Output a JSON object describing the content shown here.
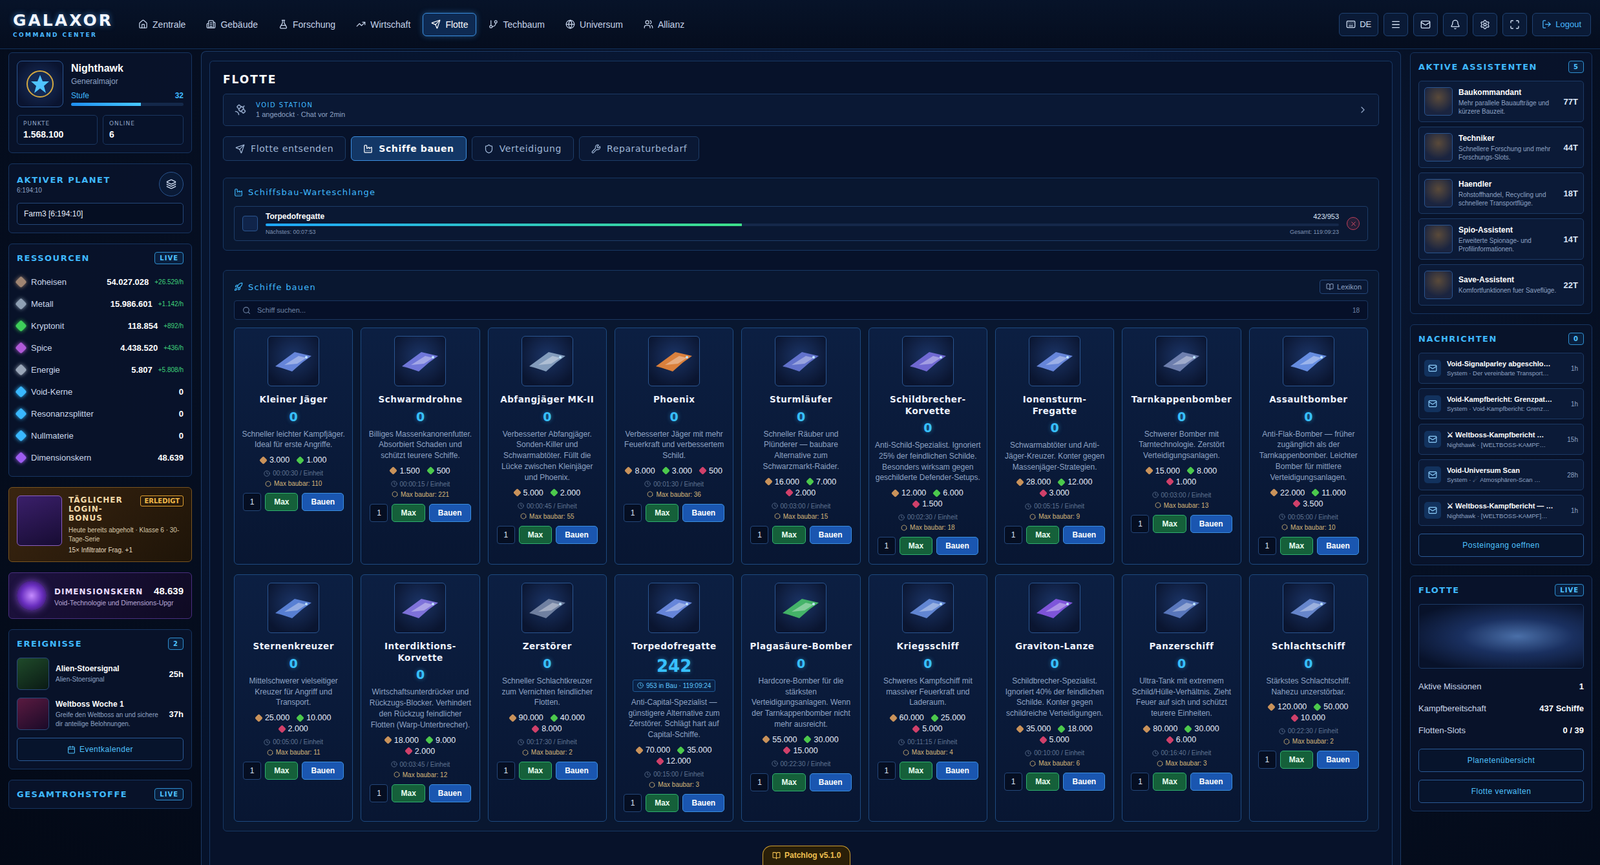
{
  "brand": {
    "name": "GALAXOR",
    "tagline": "COMMAND CENTER"
  },
  "nav": [
    {
      "label": "Zentrale",
      "selected": false
    },
    {
      "label": "Gebäude",
      "selected": false
    },
    {
      "label": "Forschung",
      "selected": false
    },
    {
      "label": "Wirtschaft",
      "selected": false
    },
    {
      "label": "Flotte",
      "selected": true
    },
    {
      "label": "Techbaum",
      "selected": false
    },
    {
      "label": "Universum",
      "selected": false
    },
    {
      "label": "Allianz",
      "selected": false
    }
  ],
  "toolbar": {
    "language": "DE",
    "logout": "Logout"
  },
  "profile": {
    "name": "Nighthawk",
    "rank": "Generalmajor",
    "level_label": "Stufe",
    "level": "32",
    "xp_level": 0.62,
    "stats": [
      {
        "label": "PUNKTE",
        "value": "1.568.100"
      },
      {
        "label": "ONLINE",
        "value": "6"
      }
    ]
  },
  "planet": {
    "title": "AKTIVER PLANET",
    "coords": "6:194:10",
    "selected_planet": "Farm3 [6:194:10]"
  },
  "resources": {
    "title": "RESSOURCEN",
    "badge": "LIVE",
    "items": [
      {
        "name": "Roheisen",
        "value": "54.027.028",
        "rate": "+26.529/h",
        "color": "#a08572"
      },
      {
        "name": "Metall",
        "value": "15.986.601",
        "rate": "+1.142/h",
        "color": "#8fa0b3"
      },
      {
        "name": "Kryptonit",
        "value": "118.854",
        "rate": "+892/h",
        "color": "#3ecf5a"
      },
      {
        "name": "Spice",
        "value": "4.438.520",
        "rate": "+436/h",
        "color": "#b05ad8"
      },
      {
        "name": "Energie",
        "value": "5.807",
        "rate": "+5.808/h",
        "color": "#9aa6b8"
      },
      {
        "name": "Void-Kerne",
        "value": "0",
        "color": "#39b8ff"
      },
      {
        "name": "Resonanzsplitter",
        "value": "0",
        "color": "#39b8ff"
      },
      {
        "name": "Nullmaterie",
        "value": "0",
        "color": "#39b8ff"
      },
      {
        "name": "Dimensionskern",
        "value": "48.639",
        "color": "#9d5cf0"
      }
    ]
  },
  "daily_bonus": {
    "title": "TÄGLICHER LOGIN-BONUS",
    "badge": "ERLEDIGT",
    "text": "Heute bereits abgeholt · Klasse 6 · 30-Tage-Serie",
    "reward": "15× Infiltrator Frag. +1"
  },
  "dimension_core": {
    "title": "DIMENSIONSKERN",
    "value": "48.639",
    "text": "Void-Technologie und Dimensions-Upgr"
  },
  "events": {
    "title": "EREIGNISSE",
    "count": "2",
    "items": [
      {
        "name": "Alien-Stoersignal",
        "text": "Alien-Stoersignal",
        "time": "25h"
      },
      {
        "name": "Weltboss Woche 1",
        "text": "Greife den Weltboss an und sichere dir anteilige Belohnungen.",
        "time": "37h"
      }
    ],
    "button": "Eventkalender"
  },
  "total_resources": {
    "title": "GESAMTROHSTOFFE",
    "badge": "LIVE"
  },
  "fleet_panel": {
    "title": "FLOTTE",
    "station": {
      "label": "VOID STATION",
      "text": "1 angedockt · Chat vor 2min"
    },
    "tabs": [
      {
        "label": "Flotte entsenden",
        "selected": false
      },
      {
        "label": "Schiffe bauen",
        "selected": true
      },
      {
        "label": "Verteidigung",
        "selected": false
      },
      {
        "label": "Reparaturbedarf",
        "selected": false
      }
    ],
    "queue": {
      "title": "Schiffsbau-Warteschlange",
      "item": {
        "name": "Torpedofregatte",
        "next": "Nächstes: 00:07:53",
        "progress": "423/953",
        "level": 0.444,
        "total": "Gesamt: 119:09:23"
      }
    },
    "builder": {
      "title": "Schiffe bauen",
      "lexicon": "Lexikon",
      "search_placeholder": "Schiff suchen...",
      "count": "18",
      "quantity": "1",
      "max_button": "Max",
      "build_button": "Bauen",
      "ships": [
        {
          "name": "Kleiner Jäger",
          "count": "0",
          "text": "Schneller leichter Kampfjäger. Ideal für erste Angriffe.",
          "costs": [
            {
              "amount": "3.000",
              "color": "#c9925a"
            },
            {
              "amount": "1.000",
              "color": "#4cc94c"
            }
          ],
          "time": "00:00:30 / Einheit",
          "max": "Max baubar: 110",
          "color": "#6f8fe8"
        },
        {
          "name": "Schwarmdrohne",
          "count": "0",
          "text": "Billiges Massenkanonenfutter. Absorbiert Schaden und schützt teurere Schiffe.",
          "costs": [
            {
              "amount": "1.500",
              "color": "#c9925a"
            },
            {
              "amount": "500",
              "color": "#4cc94c"
            }
          ],
          "time": "00:00:15 / Einheit",
          "max": "Max baubar: 221",
          "color": "#7a80e8"
        },
        {
          "name": "Abfangjäger MK-II",
          "count": "0",
          "text": "Verbesserter Abfangjäger. Sonden-Killer und Schwarmabtöter. Füllt die Lücke zwischen Kleinjäger und Phoenix.",
          "costs": [
            {
              "amount": "5.000",
              "color": "#c9925a"
            },
            {
              "amount": "2.000",
              "color": "#4cc94c"
            }
          ],
          "time": "00:00:45 / Einheit",
          "max": "Max baubar: 55",
          "color": "#8fa8c8"
        },
        {
          "name": "Phoenix",
          "count": "0",
          "text": "Verbesserter Jäger mit mehr Feuerkraft und verbessertem Schild.",
          "costs": [
            {
              "amount": "8.000",
              "color": "#c9925a"
            },
            {
              "amount": "3.000",
              "color": "#4cc94c"
            },
            {
              "amount": "500",
              "color": "#d0406a"
            }
          ],
          "time": "00:01:30 / Einheit",
          "max": "Max baubar: 36",
          "color": "#f08a3a"
        },
        {
          "name": "Sturmläufer",
          "count": "0",
          "text": "Schneller Räuber und Plünderer — baubare Alternative zum Schwarzmarkt-Raider.",
          "costs": [
            {
              "amount": "16.000",
              "color": "#c9925a"
            },
            {
              "amount": "7.000",
              "color": "#4cc94c"
            },
            {
              "amount": "2.000",
              "color": "#d0406a"
            }
          ],
          "time": "00:03:00 / Einheit",
          "max": "Max baubar: 15",
          "color": "#6a7ad8"
        },
        {
          "name": "Schildbrecher-Korvette",
          "count": "0",
          "text": "Anti-Schild-Spezialist. Ignoriert 25% der feindlichen Schilde. Besonders wirksam gegen geschilderte Defender-Setups.",
          "costs": [
            {
              "amount": "12.000",
              "color": "#c9925a"
            },
            {
              "amount": "6.000",
              "color": "#4cc94c"
            },
            {
              "amount": "1.500",
              "color": "#d0406a"
            }
          ],
          "time": "00:02:30 / Einheit",
          "max": "Max baubar: 18",
          "color": "#7a70e0"
        },
        {
          "name": "Ionensturm-Fregatte",
          "count": "0",
          "text": "Schwarmabtöter und Anti-Jäger-Kreuzer. Konter gegen Massenjäger-Strategien.",
          "costs": [
            {
              "amount": "28.000",
              "color": "#c9925a"
            },
            {
              "amount": "12.000",
              "color": "#4cc94c"
            },
            {
              "amount": "3.000",
              "color": "#d0406a"
            }
          ],
          "time": "00:05:15 / Einheit",
          "max": "Max baubar: 9",
          "color": "#6f8fe8"
        },
        {
          "name": "Tarnkappenbomber",
          "count": "0",
          "text": "Schwerer Bomber mit Tarntechnologie. Zerstört Verteidigungsanlagen.",
          "costs": [
            {
              "amount": "15.000",
              "color": "#c9925a"
            },
            {
              "amount": "8.000",
              "color": "#4cc94c"
            },
            {
              "amount": "1.000",
              "color": "#d0406a"
            }
          ],
          "time": "00:03:00 / Einheit",
          "max": "Max baubar: 13",
          "color": "#7888b8"
        },
        {
          "name": "Assaultbomber",
          "count": "0",
          "text": "Anti-Flak-Bomber — früher zugänglich als der Tarnkappenbomber. Leichter Bomber für mittlere Verteidigungsanlagen.",
          "costs": [
            {
              "amount": "22.000",
              "color": "#c9925a"
            },
            {
              "amount": "11.000",
              "color": "#4cc94c"
            },
            {
              "amount": "3.500",
              "color": "#d0406a"
            }
          ],
          "time": "00:05:00 / Einheit",
          "max": "Max baubar: 10",
          "color": "#6f98f0"
        },
        {
          "name": "Sternenkreuzer",
          "count": "0",
          "text": "Mittelschwerer vielseitiger Kreuzer für Angriff und Transport.",
          "costs": [
            {
              "amount": "25.000",
              "color": "#c9925a"
            },
            {
              "amount": "10.000",
              "color": "#4cc94c"
            },
            {
              "amount": "2.000",
              "color": "#d0406a"
            }
          ],
          "time": "00:05:00 / Einheit",
          "max": "Max baubar: 11",
          "color": "#5f88e0"
        },
        {
          "name": "Interdiktions-Korvette",
          "count": "0",
          "text": "Wirtschaftsunterdrücker und Rückzugs-Blocker. Verhindert den Rückzug feindlicher Flotten (Warp-Unterbrecher).",
          "costs": [
            {
              "amount": "18.000",
              "color": "#c9925a"
            },
            {
              "amount": "9.000",
              "color": "#4cc94c"
            },
            {
              "amount": "2.000",
              "color": "#d0406a"
            }
          ],
          "time": "00:03:45 / Einheit",
          "max": "Max baubar: 12",
          "color": "#8a7ae8"
        },
        {
          "name": "Zerstörer",
          "count": "0",
          "text": "Schneller Schlachtkreuzer zum Vernichten feindlicher Flotten.",
          "costs": [
            {
              "amount": "90.000",
              "color": "#c9925a"
            },
            {
              "amount": "40.000",
              "color": "#4cc94c"
            },
            {
              "amount": "8.000",
              "color": "#d0406a"
            }
          ],
          "time": "00:17:30 / Einheit",
          "max": "Max baubar: 2",
          "color": "#7a8aa8"
        },
        {
          "name": "Torpedofregatte",
          "count": "242",
          "in_build": "953 in Bau · 119:09:24",
          "text": "Anti-Capital-Spezialist — günstigere Alternative zum Zerstörer. Schlägt hart auf Capital-Schiffe.",
          "costs": [
            {
              "amount": "70.000",
              "color": "#c9925a"
            },
            {
              "amount": "35.000",
              "color": "#4cc94c"
            },
            {
              "amount": "12.000",
              "color": "#d0406a"
            }
          ],
          "time": "00:15:00 / Einheit",
          "max": "Max baubar: 3",
          "color": "#6f8fe8"
        },
        {
          "name": "Plagasäure-Bomber",
          "count": "0",
          "text": "Hardcore-Bomber für die stärksten Verteidigungsanlagen. Wenn der Tarnkappenbomber nicht mehr ausreicht.",
          "costs": [
            {
              "amount": "55.000",
              "color": "#c9925a"
            },
            {
              "amount": "30.000",
              "color": "#4cc94c"
            },
            {
              "amount": "15.000",
              "color": "#d0406a"
            }
          ],
          "time": "00:22:30 / Einheit",
          "color": "#49c26a"
        },
        {
          "name": "Kriegsschiff",
          "count": "0",
          "text": "Schweres Kampfschiff mit massiver Feuerkraft und Laderaum.",
          "costs": [
            {
              "amount": "60.000",
              "color": "#c9925a"
            },
            {
              "amount": "25.000",
              "color": "#4cc94c"
            },
            {
              "amount": "5.000",
              "color": "#d0406a"
            }
          ],
          "time": "00:11:15 / Einheit",
          "max": "Max baubar: 4",
          "color": "#6a90e0"
        },
        {
          "name": "Graviton-Lanze",
          "count": "0",
          "text": "Schildbrecher-Spezialist. Ignoriert 40% der feindlichen Schilde. Konter gegen schildreiche Verteidigungen.",
          "costs": [
            {
              "amount": "35.000",
              "color": "#c9925a"
            },
            {
              "amount": "18.000",
              "color": "#4cc94c"
            },
            {
              "amount": "5.000",
              "color": "#d0406a"
            }
          ],
          "time": "00:10:00 / Einheit",
          "max": "Max baubar: 6",
          "color": "#8a5ae8"
        },
        {
          "name": "Panzerschiff",
          "count": "0",
          "text": "Ultra-Tank mit extremem Schild/Hülle-Verhältnis. Zieht Feuer auf sich und schützt teurere Einheiten.",
          "costs": [
            {
              "amount": "80.000",
              "color": "#c9925a"
            },
            {
              "amount": "30.000",
              "color": "#4cc94c"
            },
            {
              "amount": "6.000",
              "color": "#d0406a"
            }
          ],
          "time": "00:16:40 / Einheit",
          "max": "Max baubar: 3",
          "color": "#6080c8"
        },
        {
          "name": "Schlachtschiff",
          "count": "0",
          "text": "Stärkstes Schlachtschiff. Nahezu unzerstörbar.",
          "costs": [
            {
              "amount": "120.000",
              "color": "#c9925a"
            },
            {
              "amount": "50.000",
              "color": "#4cc94c"
            },
            {
              "amount": "10.000",
              "color": "#d0406a"
            }
          ],
          "time": "00:22:30 / Einheit",
          "max": "Max baubar: 2",
          "color": "#7090d8"
        }
      ]
    }
  },
  "assistants": {
    "title": "AKTIVE ASSISTENTEN",
    "count": "5",
    "items": [
      {
        "name": "Baukommandant",
        "text": "Mehr parallele Bauaufträge und kürzere Bauzeit.",
        "days": "77T"
      },
      {
        "name": "Techniker",
        "text": "Schnellere Forschung und mehr Forschungs-Slots.",
        "days": "44T"
      },
      {
        "name": "Haendler",
        "text": "Rohstoffhandel, Recycling und schnellere Transportflüge.",
        "days": "18T"
      },
      {
        "name": "Spio-Assistent",
        "text": "Erweiterte Spionage- und Profilinformationen.",
        "days": "14T"
      },
      {
        "name": "Save-Assistent",
        "text": "Komfortfunktionen fuer Saveflüge.",
        "days": "22T"
      }
    ]
  },
  "messages": {
    "title": "NACHRICHTEN",
    "count": "0",
    "items": [
      {
        "title": "Void-Signalparley abgeschlo…",
        "sub": "System · Der vereinbarte Transport…",
        "time": "1h"
      },
      {
        "title": "Void-Kampfbericht: Grenzpat…",
        "sub": "System · Void-Kampfbericht: Grenz…",
        "time": "1h"
      },
      {
        "title": "⚔ Weltboss-Kampfbericht …",
        "sub": "Nighthawk · [WELTBOSS-KAMPF…",
        "time": "15h"
      },
      {
        "title": "Void-Universum Scan",
        "sub": "System · ☄ Atmosphären-Scan …",
        "time": "28h"
      },
      {
        "title": "⚔ Weltboss-Kampfbericht — …",
        "sub": "Nighthawk · [WELTBOSS-KAMPF]…",
        "time": "1h"
      }
    ],
    "button": "Posteingang oeffnen"
  },
  "fleet_summary": {
    "title": "FLOTTE",
    "badge": "LIVE",
    "rows": [
      {
        "label": "Aktive Missionen",
        "value": "1"
      },
      {
        "label": "Kampfbereitschaft",
        "value": "437 Schiffe"
      },
      {
        "label": "Flotten-Slots",
        "value": "0 / 39"
      }
    ],
    "buttons": [
      "Planetenübersicht",
      "Flotte verwalten"
    ]
  },
  "patchlog": "Patchlog v5.1.0"
}
